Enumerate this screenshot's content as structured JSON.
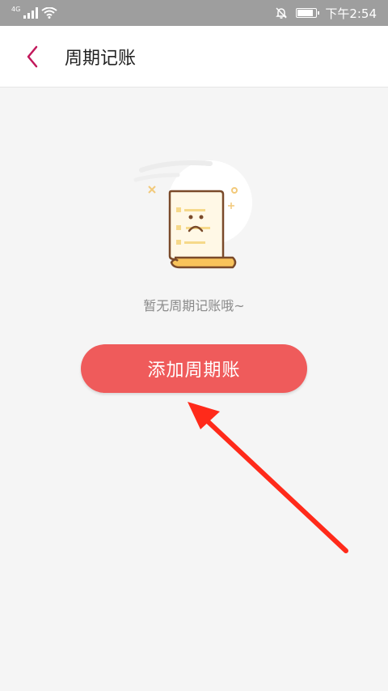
{
  "status_bar": {
    "network_label": "4G",
    "time": "下午2:54",
    "battery_level": 0.85
  },
  "header": {
    "title": "周期记账",
    "back_icon": "chevron-left-icon",
    "accent_color": "#c2185b"
  },
  "empty_state": {
    "message": "暂无周期记账哦~",
    "illustration_icon": "empty-ledger-icon"
  },
  "primary_action": {
    "label": "添加周期账",
    "color": "#ef5b5b"
  },
  "annotation": {
    "arrow_color": "#ff2a1a"
  }
}
